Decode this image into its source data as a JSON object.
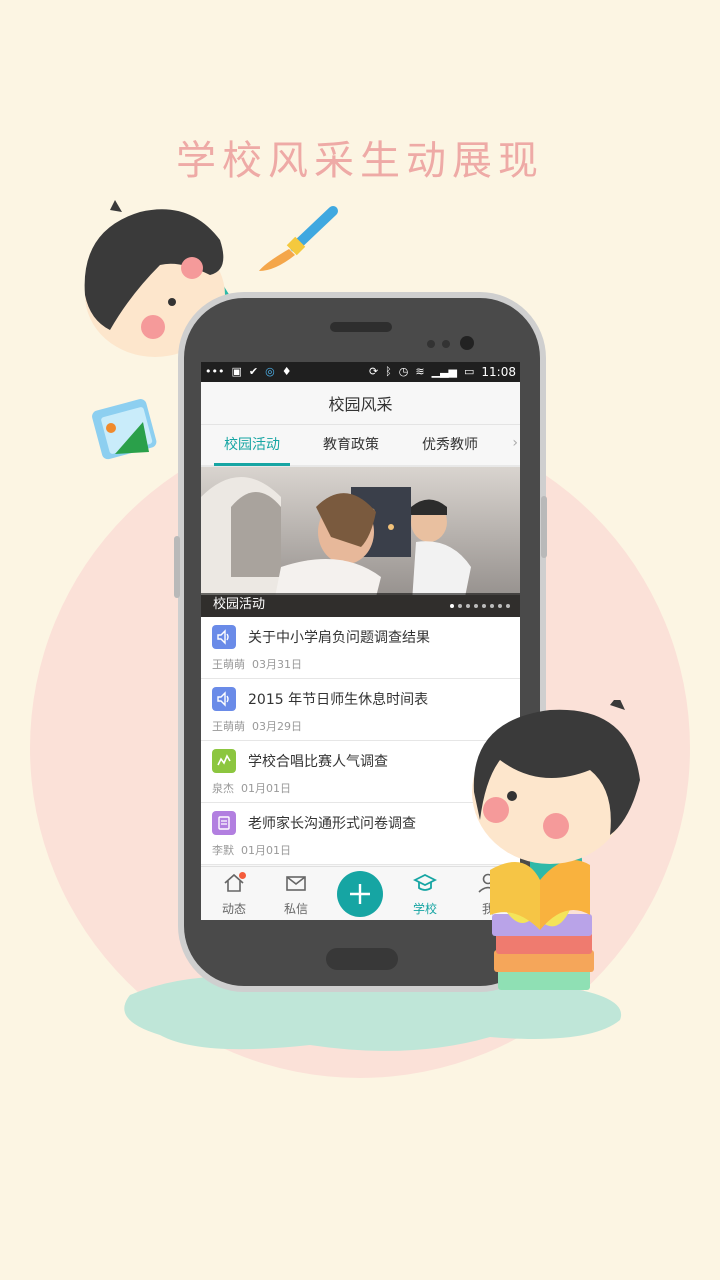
{
  "headline": "学校风采生动展现",
  "status_bar": {
    "time": "11:08"
  },
  "app": {
    "title": "校园风采",
    "tabs": [
      {
        "label": "校园活动",
        "active": true
      },
      {
        "label": "教育政策",
        "active": false
      },
      {
        "label": "优秀教师",
        "active": false
      }
    ],
    "banner": {
      "caption": "校园活动",
      "slides": 8,
      "current_slide": 1
    },
    "items": [
      {
        "icon": "speaker-icon",
        "title": "关于中小学肩负问题调查结果",
        "author": "王萌萌",
        "date": "03月31日"
      },
      {
        "icon": "speaker-icon",
        "title": "2015 年节日师生休息时间表",
        "author": "王萌萌",
        "date": "03月29日"
      },
      {
        "icon": "chart-icon",
        "title": "学校合唱比赛人气调查",
        "author": "泉杰",
        "date": "01月01日"
      },
      {
        "icon": "document-icon",
        "title": "老师家长沟通形式问卷调查",
        "author": "李默",
        "date": "01月01日"
      }
    ],
    "nav": [
      {
        "label": "动态",
        "icon": "home-icon"
      },
      {
        "label": "私信",
        "icon": "mail-icon"
      },
      {
        "label": "",
        "icon": "plus-icon"
      },
      {
        "label": "学校",
        "icon": "school-cap-icon",
        "active": true
      },
      {
        "label": "我",
        "icon": "person-icon"
      }
    ]
  },
  "colors": {
    "accent": "#16a5a3",
    "headline": "#eeaaa6",
    "background": "#fcf5e3",
    "speaker_icon": "#6a8be8",
    "chart_icon": "#8cc63f",
    "doc_icon": "#b27fe0"
  }
}
